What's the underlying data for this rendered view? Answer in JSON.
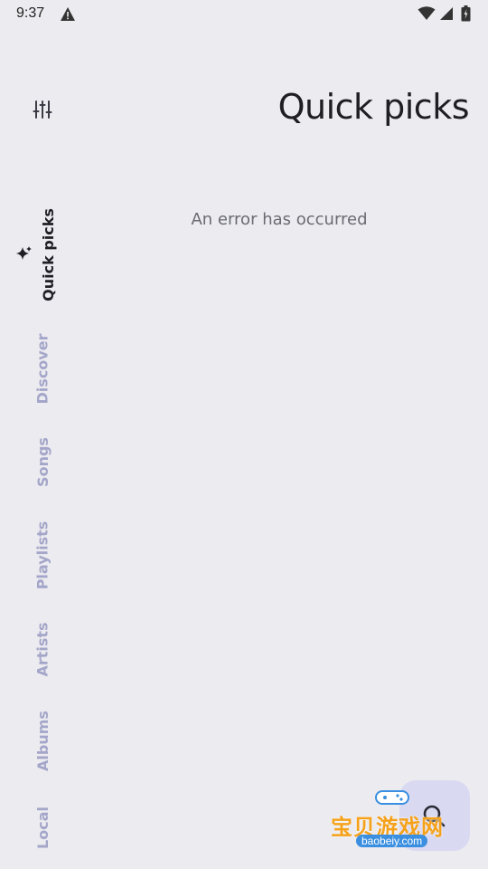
{
  "status_bar": {
    "time": "9:37",
    "icons": [
      "warning-icon",
      "wifi-icon",
      "signal-icon",
      "battery-icon"
    ]
  },
  "header": {
    "title": "Quick picks"
  },
  "main": {
    "error_message": "An error has occurred"
  },
  "sidebar": {
    "settings_icon": "tune-icon",
    "items": [
      {
        "label": "Quick picks",
        "active": true,
        "icon": "sparkle-icon"
      },
      {
        "label": "Discover",
        "active": false
      },
      {
        "label": "Songs",
        "active": false
      },
      {
        "label": "Playlists",
        "active": false
      },
      {
        "label": "Artists",
        "active": false
      },
      {
        "label": "Albums",
        "active": false
      },
      {
        "label": "Local",
        "active": false
      }
    ]
  },
  "fab": {
    "icon": "search-icon"
  },
  "watermark": {
    "text": "宝贝游戏网",
    "url": "baobeiy.com"
  },
  "colors": {
    "background": "#ECEBF0",
    "active_nav": "#1E1E24",
    "inactive_nav": "#A4A6C9",
    "fab_bg": "#D9D9F2"
  }
}
